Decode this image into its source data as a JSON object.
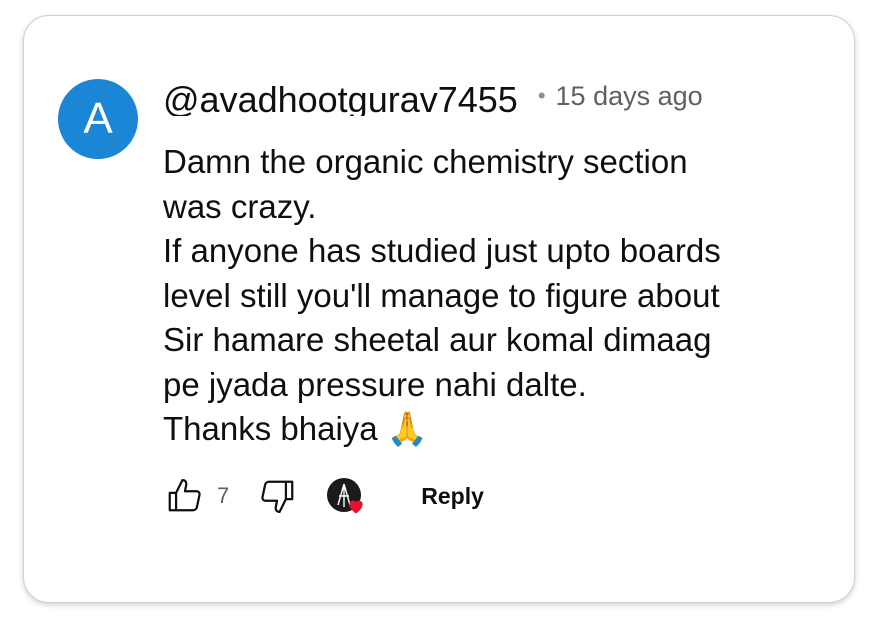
{
  "comment": {
    "avatar_letter": "A",
    "avatar_color": "#1b85d6",
    "username": "@avadhootgurav7455",
    "separator": "•",
    "time_ago": "15 days ago",
    "text": "Damn the organic chemistry section\nwas crazy.\nIf anyone has studied just upto boards\nlevel still you'll manage to figure about\nSir hamare sheetal aur komal dimaag\npe jyada pressure nahi dalte.\nThanks bhaiya 🙏"
  },
  "actions": {
    "like_icon": "thumbs-up-icon",
    "like_count": "7",
    "dislike_icon": "thumbs-down-icon",
    "creator_heart_icon": "creator-heart-icon",
    "heart_color": "#e8112d",
    "reply_label": "Reply"
  }
}
